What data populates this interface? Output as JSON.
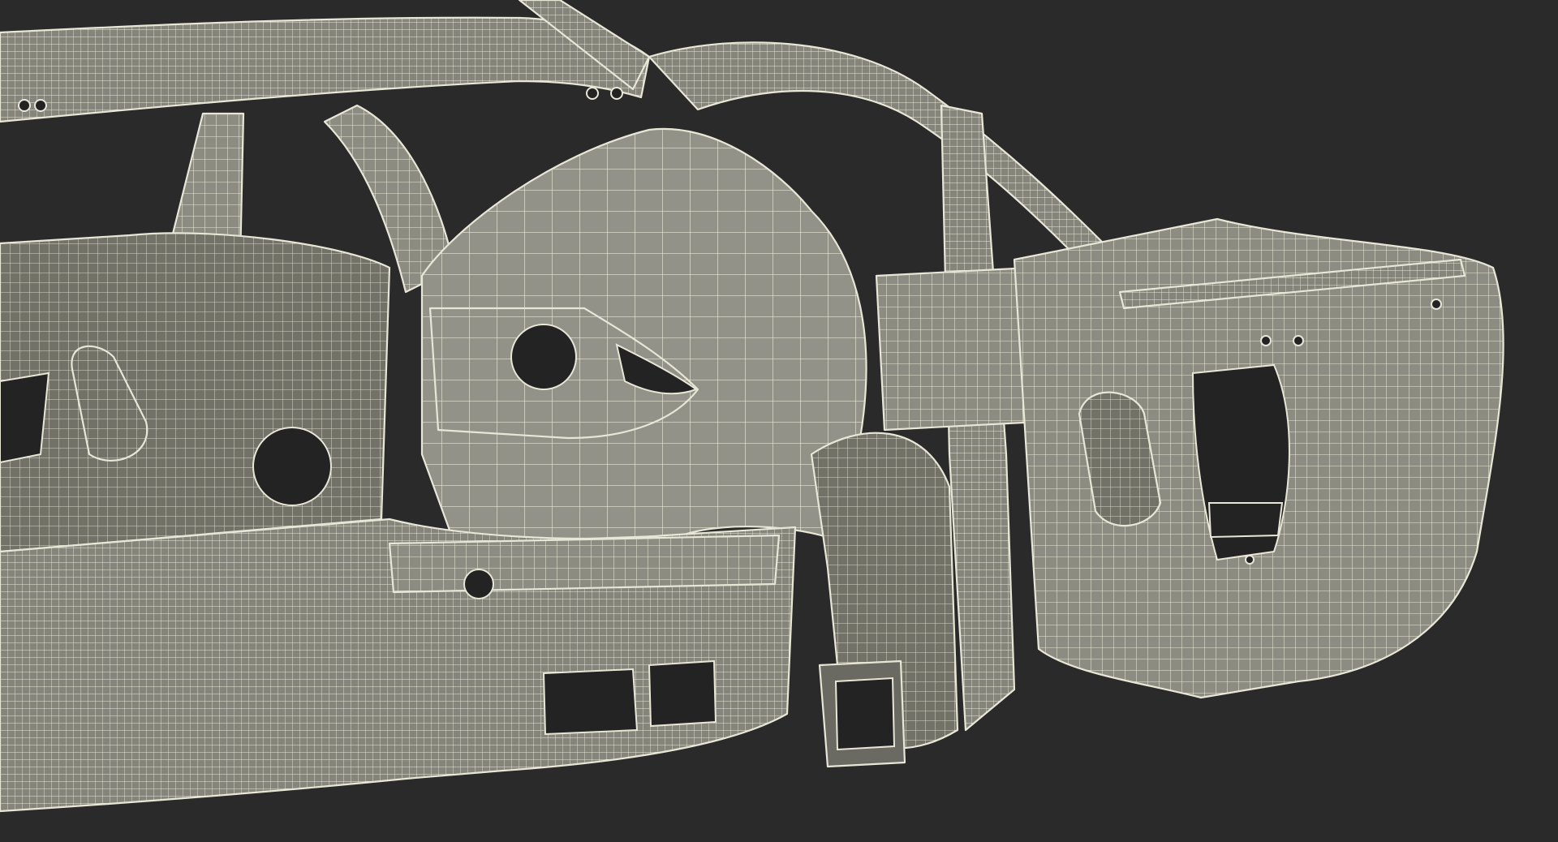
{
  "scene": {
    "kind": "3d-wireframe-render",
    "subject": "car-body-in-white-rear-quarter",
    "colors": {
      "background": "#2a2a2a",
      "panel_fill": "#8a8a80",
      "panel_fill_light": "#9b9b90",
      "panel_fill_dark": "#6f6f68",
      "wire": "#e8e6d6",
      "hole": "#232323"
    }
  }
}
